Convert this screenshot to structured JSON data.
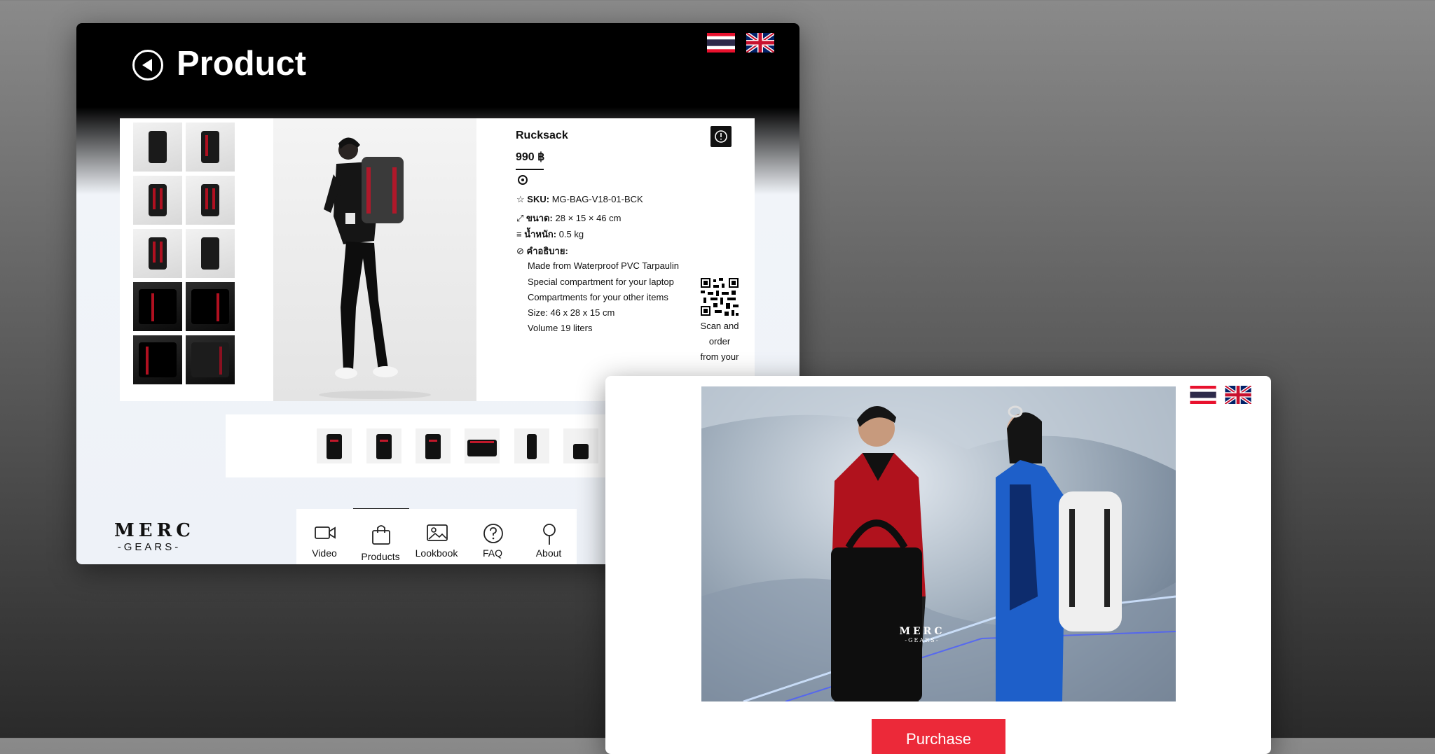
{
  "window1": {
    "header": {
      "title": "Product"
    },
    "product": {
      "name": "Rucksack",
      "price": "990 ฿",
      "sku_label": "SKU:",
      "sku_value": "MG-BAG-V18-01-BCK",
      "size_label": "ขนาด:",
      "size_value": "28 × 15 × 46 cm",
      "weight_label": "น้ำหนัก:",
      "weight_value": "0.5 kg",
      "desc_label": "คำอธิบาย:",
      "description": [
        "Made from Waterproof PVC Tarpaulin",
        "Special compartment for your laptop",
        "Compartments for your other items",
        "Size: 46 x 28 x 15 cm",
        "Volume 19 liters"
      ],
      "qr_caption": [
        "Scan and",
        "order",
        "from your"
      ]
    },
    "brand": {
      "line1": "MERC",
      "line2": "-GEARS-"
    },
    "nav": [
      {
        "label": "Video",
        "icon": "video-camera-icon"
      },
      {
        "label": "Products",
        "icon": "shopping-bag-icon",
        "active": true
      },
      {
        "label": "Lookbook",
        "icon": "image-icon"
      },
      {
        "label": "FAQ",
        "icon": "question-icon"
      },
      {
        "label": "About",
        "icon": "location-pin-icon"
      }
    ]
  },
  "window2": {
    "purchase_label": "Purchase",
    "bag_logo": {
      "line1": "MERC",
      "line2": "-GEARS-"
    }
  },
  "colors": {
    "accent": "#ec2939",
    "header": "#000000",
    "page_bg": "#eef2f8"
  }
}
